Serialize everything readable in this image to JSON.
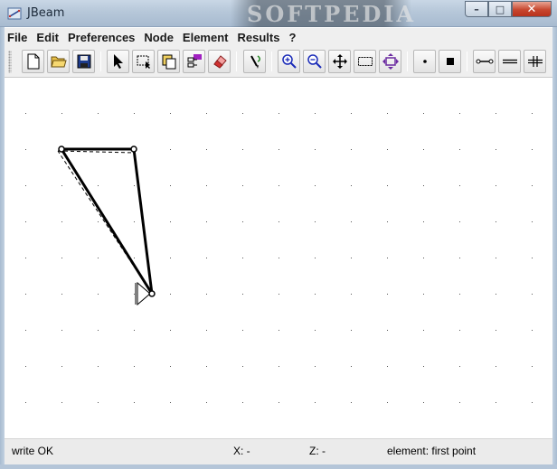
{
  "window": {
    "title": "JBeam",
    "watermark": "SOFTPEDIA",
    "controls": [
      "minimize",
      "maximize",
      "close"
    ]
  },
  "menu": {
    "items": [
      "File",
      "Edit",
      "Preferences",
      "Node",
      "Element",
      "Results",
      "?"
    ]
  },
  "toolbar": {
    "buttons": [
      {
        "name": "new-file-icon"
      },
      {
        "name": "open-folder-icon"
      },
      {
        "name": "save-disk-icon"
      },
      {
        "name": "select-arrow-icon"
      },
      {
        "name": "select-rectangle-icon"
      },
      {
        "name": "copy-icon"
      },
      {
        "name": "properties-icon"
      },
      {
        "name": "eraser-icon"
      },
      {
        "name": "pen-tool-icon"
      },
      {
        "name": "zoom-in-icon"
      },
      {
        "name": "zoom-out-icon"
      },
      {
        "name": "pan-move-icon"
      },
      {
        "name": "zoom-window-icon"
      },
      {
        "name": "fit-all-icon"
      },
      {
        "name": "small-node-icon"
      },
      {
        "name": "large-node-icon"
      },
      {
        "name": "beam-element-icon"
      },
      {
        "name": "double-line-icon"
      },
      {
        "name": "grid-line-icon"
      }
    ],
    "accent_colors": {
      "zoom": "#1a2bb8",
      "fit": "#6a2aa0",
      "save": "#1e3c8c"
    }
  },
  "status": {
    "message": "write OK",
    "x_label": "X: -",
    "z_label": "Z: -",
    "element_label": "element: first point"
  },
  "canvas": {
    "background": "#ffffff",
    "grid_dot_color": "#555555",
    "beam_color": "#000000",
    "deformed_line_style": "dashed"
  }
}
